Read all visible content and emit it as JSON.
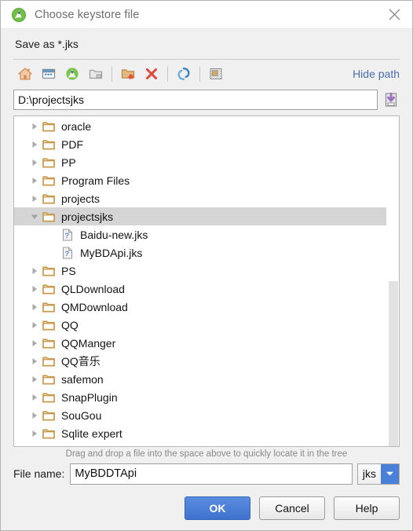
{
  "window": {
    "title": "Choose keystore file",
    "app_icon": "android-studio-icon",
    "close_label": "✕"
  },
  "saveband": {
    "label": "Save as *.jks"
  },
  "toolbar": {
    "buttons": [
      {
        "name": "home-icon",
        "tooltip": "Home"
      },
      {
        "name": "desktop-icon",
        "tooltip": "Desktop"
      },
      {
        "name": "project-icon",
        "tooltip": "Project"
      },
      {
        "name": "module-folder-icon",
        "tooltip": "Module Directory"
      },
      {
        "name": "new-folder-icon",
        "tooltip": "New Folder"
      },
      {
        "name": "delete-icon",
        "tooltip": "Delete"
      },
      {
        "name": "refresh-icon",
        "tooltip": "Refresh"
      },
      {
        "name": "show-hidden-icon",
        "tooltip": "Show Hidden Files"
      }
    ],
    "hide_path_label": "Hide path"
  },
  "path_field": {
    "value": "D:\\projectsjks",
    "placeholder": "",
    "save_icon": "save-down-icon"
  },
  "tree": {
    "rows": [
      {
        "label": "oracle",
        "indent": 1,
        "type": "folder",
        "twisty": "collapsed",
        "selected": false
      },
      {
        "label": "PDF",
        "indent": 1,
        "type": "folder",
        "twisty": "collapsed",
        "selected": false
      },
      {
        "label": "PP",
        "indent": 1,
        "type": "folder",
        "twisty": "collapsed",
        "selected": false
      },
      {
        "label": "Program Files",
        "indent": 1,
        "type": "folder",
        "twisty": "collapsed",
        "selected": false
      },
      {
        "label": "projects",
        "indent": 1,
        "type": "folder",
        "twisty": "collapsed",
        "selected": false
      },
      {
        "label": "projectsjks",
        "indent": 1,
        "type": "folder",
        "twisty": "expanded",
        "selected": true
      },
      {
        "label": "Baidu-new.jks",
        "indent": 2,
        "type": "file",
        "twisty": "none",
        "selected": false
      },
      {
        "label": "MyBDApi.jks",
        "indent": 2,
        "type": "file",
        "twisty": "none",
        "selected": false
      },
      {
        "label": "PS",
        "indent": 1,
        "type": "folder",
        "twisty": "collapsed",
        "selected": false
      },
      {
        "label": "QLDownload",
        "indent": 1,
        "type": "folder",
        "twisty": "collapsed",
        "selected": false
      },
      {
        "label": "QMDownload",
        "indent": 1,
        "type": "folder",
        "twisty": "collapsed",
        "selected": false
      },
      {
        "label": "QQ",
        "indent": 1,
        "type": "folder",
        "twisty": "collapsed",
        "selected": false
      },
      {
        "label": "QQManger",
        "indent": 1,
        "type": "folder",
        "twisty": "collapsed",
        "selected": false
      },
      {
        "label": "QQ音乐",
        "indent": 1,
        "type": "folder",
        "twisty": "collapsed",
        "selected": false
      },
      {
        "label": "safemon",
        "indent": 1,
        "type": "folder",
        "twisty": "collapsed",
        "selected": false
      },
      {
        "label": "SnapPlugin",
        "indent": 1,
        "type": "folder",
        "twisty": "collapsed",
        "selected": false
      },
      {
        "label": "SouGou",
        "indent": 1,
        "type": "folder",
        "twisty": "collapsed",
        "selected": false
      },
      {
        "label": "Sqlite expert",
        "indent": 1,
        "type": "folder",
        "twisty": "collapsed",
        "selected": false
      }
    ],
    "scrollbar": {
      "thumb_top_pct": 50,
      "thumb_height_pct": 50
    }
  },
  "drag_hint": "Drag and drop a file into the space above to quickly locate it in the tree",
  "filename_row": {
    "label": "File name:",
    "value": "MyBDDTApi",
    "placeholder": "",
    "extension": "jks",
    "extension_options": [
      "jks"
    ]
  },
  "footer": {
    "ok_label": "OK",
    "cancel_label": "Cancel",
    "help_label": "Help"
  },
  "colors": {
    "accent_blue": "#4a80d8",
    "link_blue": "#4b6ead",
    "folder_gold": "#cda253",
    "selection_gray": "#d5d5d5"
  }
}
